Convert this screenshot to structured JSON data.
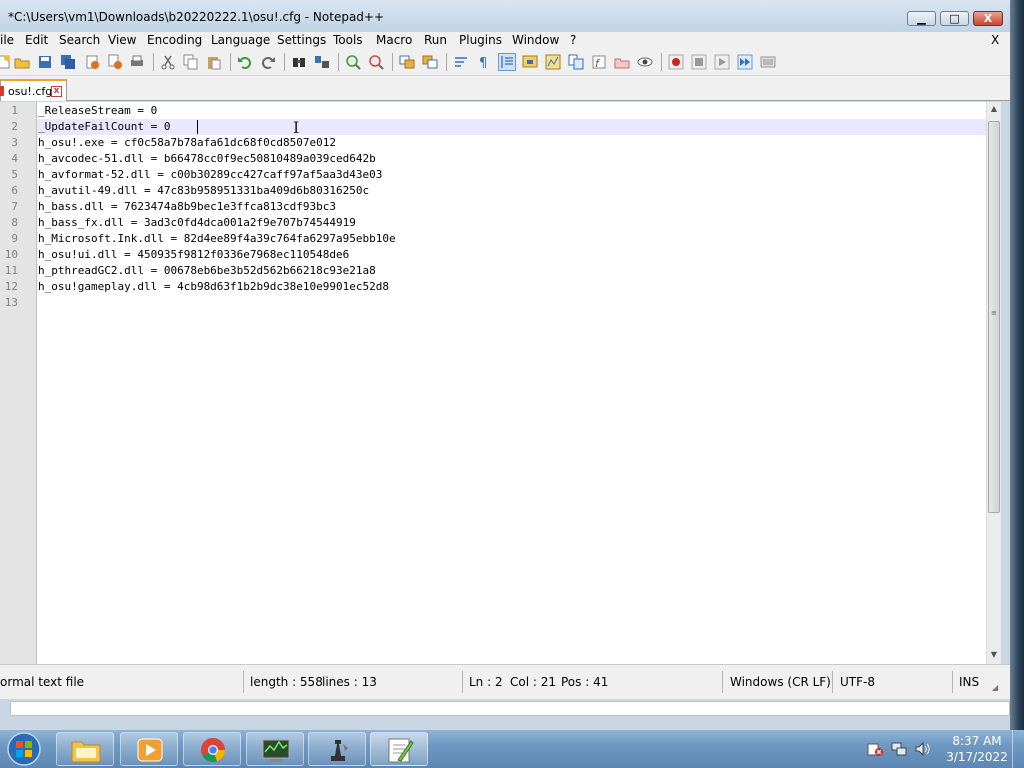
{
  "window": {
    "title": "*C:\\Users\\vm1\\Downloads\\b20220222.1\\osu!.cfg - Notepad++",
    "minimize_glyph": "▁",
    "maximize_glyph": "□",
    "close_glyph": "X"
  },
  "menu": {
    "items": [
      "ile",
      "Edit",
      "Search",
      "View",
      "Encoding",
      "Language",
      "Settings",
      "Tools",
      "Macro",
      "Run",
      "Plugins",
      "Window",
      "?"
    ],
    "close_label": "X"
  },
  "toolbar": {
    "buttons": [
      "new-file-icon",
      "open-file-icon",
      "save-icon",
      "save-all-icon",
      "close-icon",
      "close-all-icon",
      "print-icon",
      "cut-icon",
      "copy-icon",
      "paste-icon",
      "undo-icon",
      "redo-icon",
      "find-icon",
      "replace-icon",
      "zoom-in-icon",
      "zoom-out-icon",
      "sync-vertical-icon",
      "sync-horizontal-icon",
      "word-wrap-icon",
      "show-all-chars-icon",
      "indent-guide-icon",
      "user-language-icon",
      "doc-map-icon",
      "function-list-icon",
      "folder-workspace-icon",
      "monitor-icon",
      "record-macro-icon",
      "stop-macro-icon",
      "play-macro-icon",
      "run-macro-multiple-icon",
      "save-macro-icon"
    ]
  },
  "tab": {
    "label": "osu!.cfg",
    "close_glyph": "x"
  },
  "editor": {
    "lines": [
      {
        "num": "1",
        "text": "_ReleaseStream = 0"
      },
      {
        "num": "2",
        "text": "_UpdateFailCount = 0"
      },
      {
        "num": "3",
        "text": "h_osu!.exe = cf0c58a7b78afa61dc68f0cd8507e012"
      },
      {
        "num": "4",
        "text": "h_avcodec-51.dll = b66478cc0f9ec50810489a039ced642b"
      },
      {
        "num": "5",
        "text": "h_avformat-52.dll = c00b30289cc427caff97af5aa3d43e03"
      },
      {
        "num": "6",
        "text": "h_avutil-49.dll = 47c83b958951331ba409d6b80316250c"
      },
      {
        "num": "7",
        "text": "h_bass.dll = 7623474a8b9bec1e3ffca813cdf93bc3"
      },
      {
        "num": "8",
        "text": "h_bass_fx.dll = 3ad3c0fd4dca001a2f9e707b74544919"
      },
      {
        "num": "9",
        "text": "h_Microsoft.Ink.dll = 82d4ee89f4a39c764fa6297a95ebb10e"
      },
      {
        "num": "10",
        "text": "h_osu!ui.dll = 450935f9812f0336e7968ec110548de6"
      },
      {
        "num": "11",
        "text": "h_pthreadGC2.dll = 00678eb6be3b52d562b66218c93e21a8"
      },
      {
        "num": "12",
        "text": "h_osu!gameplay.dll = 4cb98d63f1b2b9dc38e10e9901ec52d8"
      },
      {
        "num": "13",
        "text": ""
      }
    ],
    "current_line": 2
  },
  "status": {
    "file_type": "ormal text file",
    "length": "length : 558",
    "lines": "lines : 13",
    "ln": "Ln : 2",
    "col": "Col : 21",
    "pos": "Pos : 41",
    "eol": "Windows (CR LF)",
    "encoding": "UTF-8",
    "mode": "INS"
  },
  "taskbar": {
    "apps": [
      "file-explorer-icon",
      "media-player-icon",
      "chrome-icon",
      "task-manager-icon",
      "chess-icon",
      "notepad-plus-plus-icon"
    ],
    "active_app": "notepad-plus-plus-icon",
    "tray_icons": [
      "action-center-icon",
      "network-icon",
      "volume-icon"
    ],
    "time": "8:37 AM",
    "date": "3/17/2022"
  }
}
